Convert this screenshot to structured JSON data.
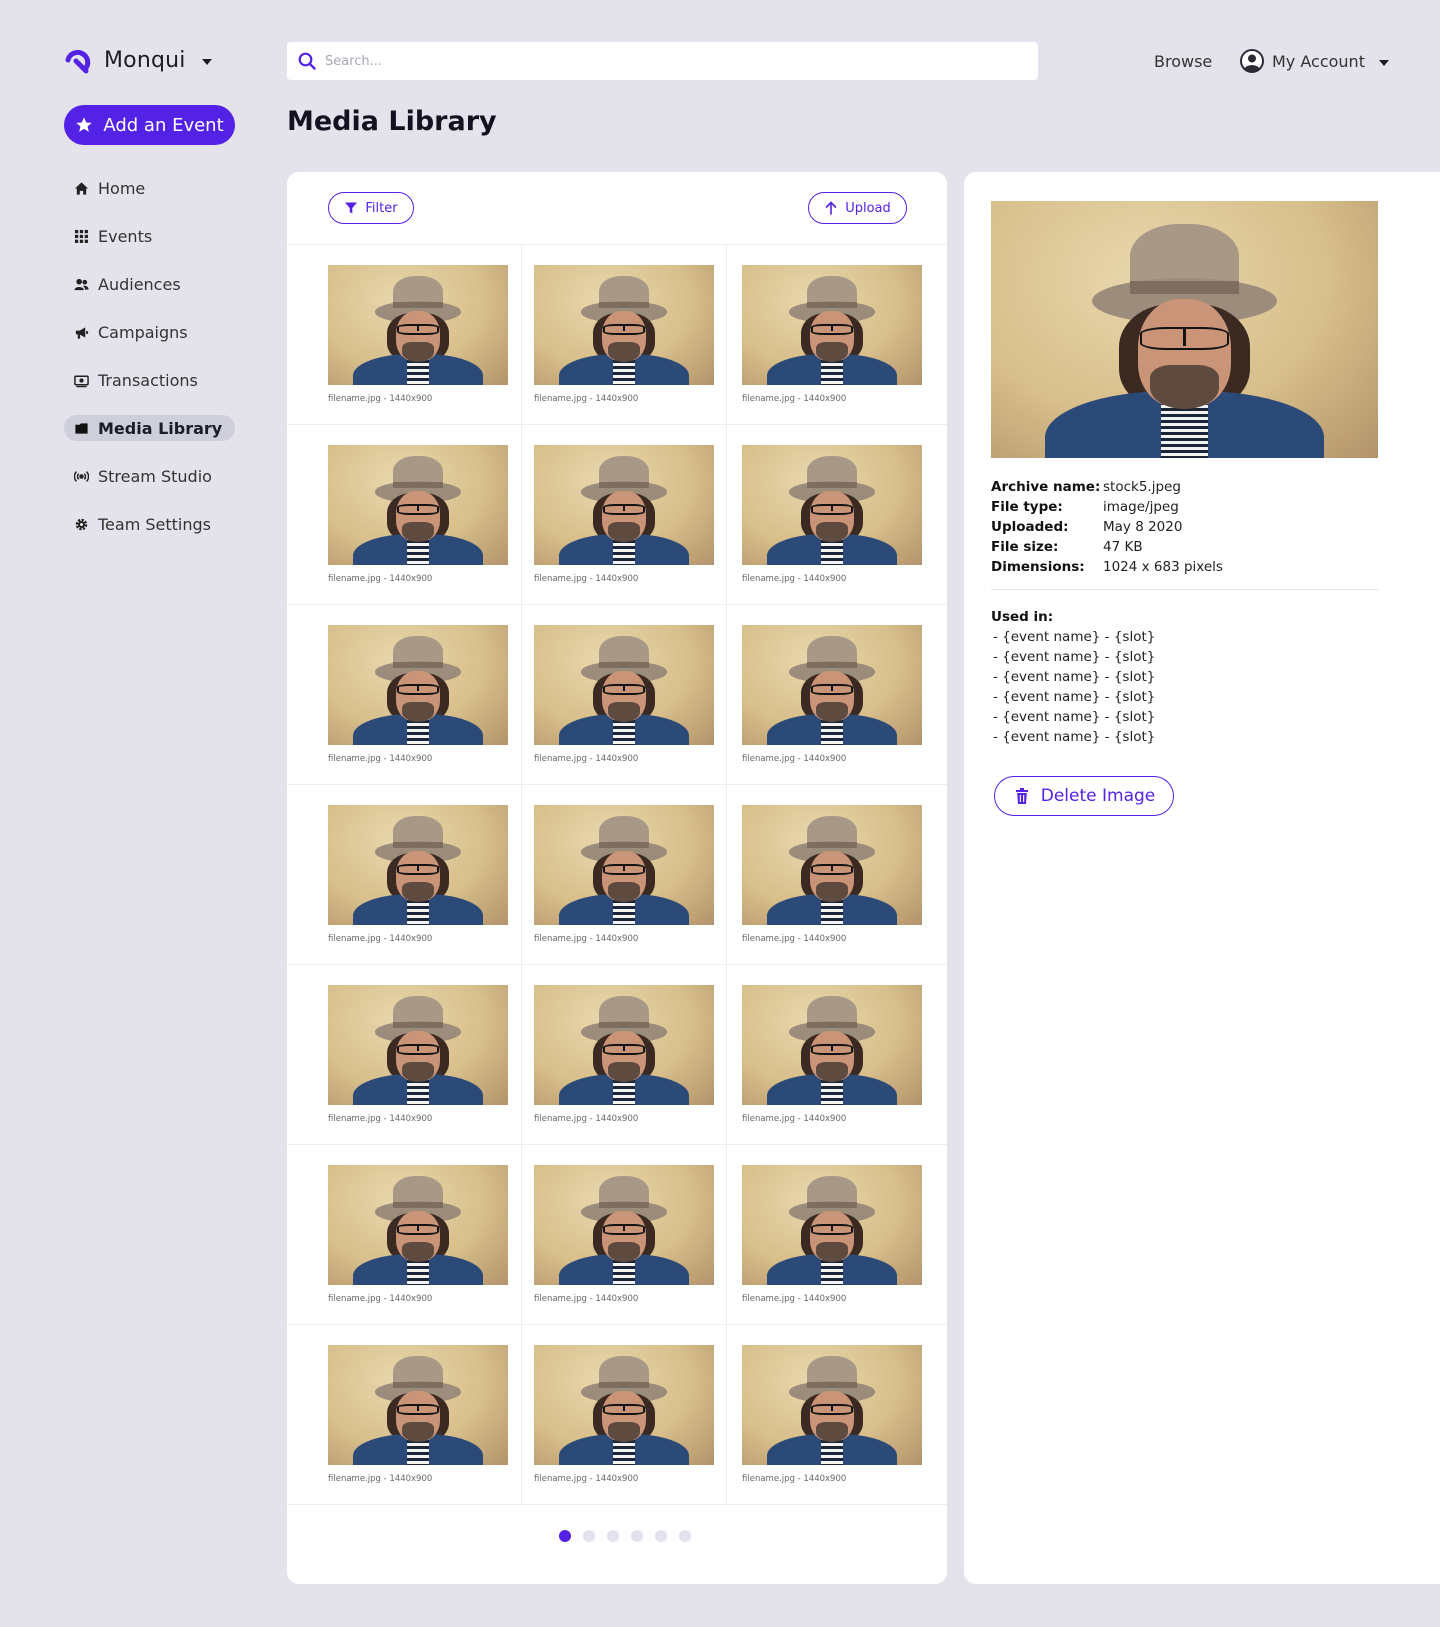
{
  "brand": {
    "name": "Monqui",
    "accent": "#5421e6"
  },
  "search": {
    "placeholder": "Search...",
    "value": ""
  },
  "header": {
    "browse_label": "Browse",
    "account_label": "My Account"
  },
  "sidebar": {
    "add_event_label": "Add an Event",
    "items": [
      {
        "label": "Home",
        "icon": "home-icon",
        "active": false
      },
      {
        "label": "Events",
        "icon": "grid-icon",
        "active": false
      },
      {
        "label": "Audiences",
        "icon": "users-icon",
        "active": false
      },
      {
        "label": "Campaigns",
        "icon": "megaphone-icon",
        "active": false
      },
      {
        "label": "Transactions",
        "icon": "money-icon",
        "active": false
      },
      {
        "label": "Media Library",
        "icon": "folder-icon",
        "active": true
      },
      {
        "label": "Stream Studio",
        "icon": "broadcast-icon",
        "active": false
      },
      {
        "label": "Team Settings",
        "icon": "gear-icon",
        "active": false
      }
    ]
  },
  "page": {
    "title": "Media Library"
  },
  "gallery": {
    "filter_label": "Filter",
    "upload_label": "Upload",
    "items": [
      {
        "caption": "filename.jpg - 1440x900"
      },
      {
        "caption": "filename.jpg - 1440x900"
      },
      {
        "caption": "filename.jpg - 1440x900"
      },
      {
        "caption": "filename.jpg - 1440x900"
      },
      {
        "caption": "filename.jpg - 1440x900"
      },
      {
        "caption": "filename.jpg - 1440x900"
      },
      {
        "caption": "filename.jpg - 1440x900"
      },
      {
        "caption": "filename.jpg - 1440x900"
      },
      {
        "caption": "filename.jpg - 1440x900"
      },
      {
        "caption": "filename.jpg - 1440x900"
      },
      {
        "caption": "filename.jpg - 1440x900"
      },
      {
        "caption": "filename.jpg - 1440x900"
      },
      {
        "caption": "filename.jpg - 1440x900"
      },
      {
        "caption": "filename.jpg - 1440x900"
      },
      {
        "caption": "filename.jpg - 1440x900"
      },
      {
        "caption": "filename.jpg - 1440x900"
      },
      {
        "caption": "filename.jpg - 1440x900"
      },
      {
        "caption": "filename.jpg - 1440x900"
      },
      {
        "caption": "filename.jpg - 1440x900"
      },
      {
        "caption": "filename.jpg - 1440x900"
      },
      {
        "caption": "filename.jpg - 1440x900"
      }
    ],
    "pagination": {
      "pages": 6,
      "current": 1
    }
  },
  "detail": {
    "meta": [
      {
        "key": "Archive name:",
        "value": "stock5.jpeg"
      },
      {
        "key": "File type:",
        "value": "image/jpeg"
      },
      {
        "key": "Uploaded:",
        "value": "May 8 2020"
      },
      {
        "key": "File size:",
        "value": "47 KB"
      },
      {
        "key": "Dimensions:",
        "value": "1024 x 683 pixels"
      }
    ],
    "used_in_label": "Used in:",
    "used_in": [
      "- {event name} - {slot}",
      "- {event name} - {slot}",
      "- {event name} - {slot}",
      "- {event name} - {slot}",
      "- {event name} - {slot}",
      "- {event name} - {slot}"
    ],
    "delete_label": "Delete Image"
  }
}
